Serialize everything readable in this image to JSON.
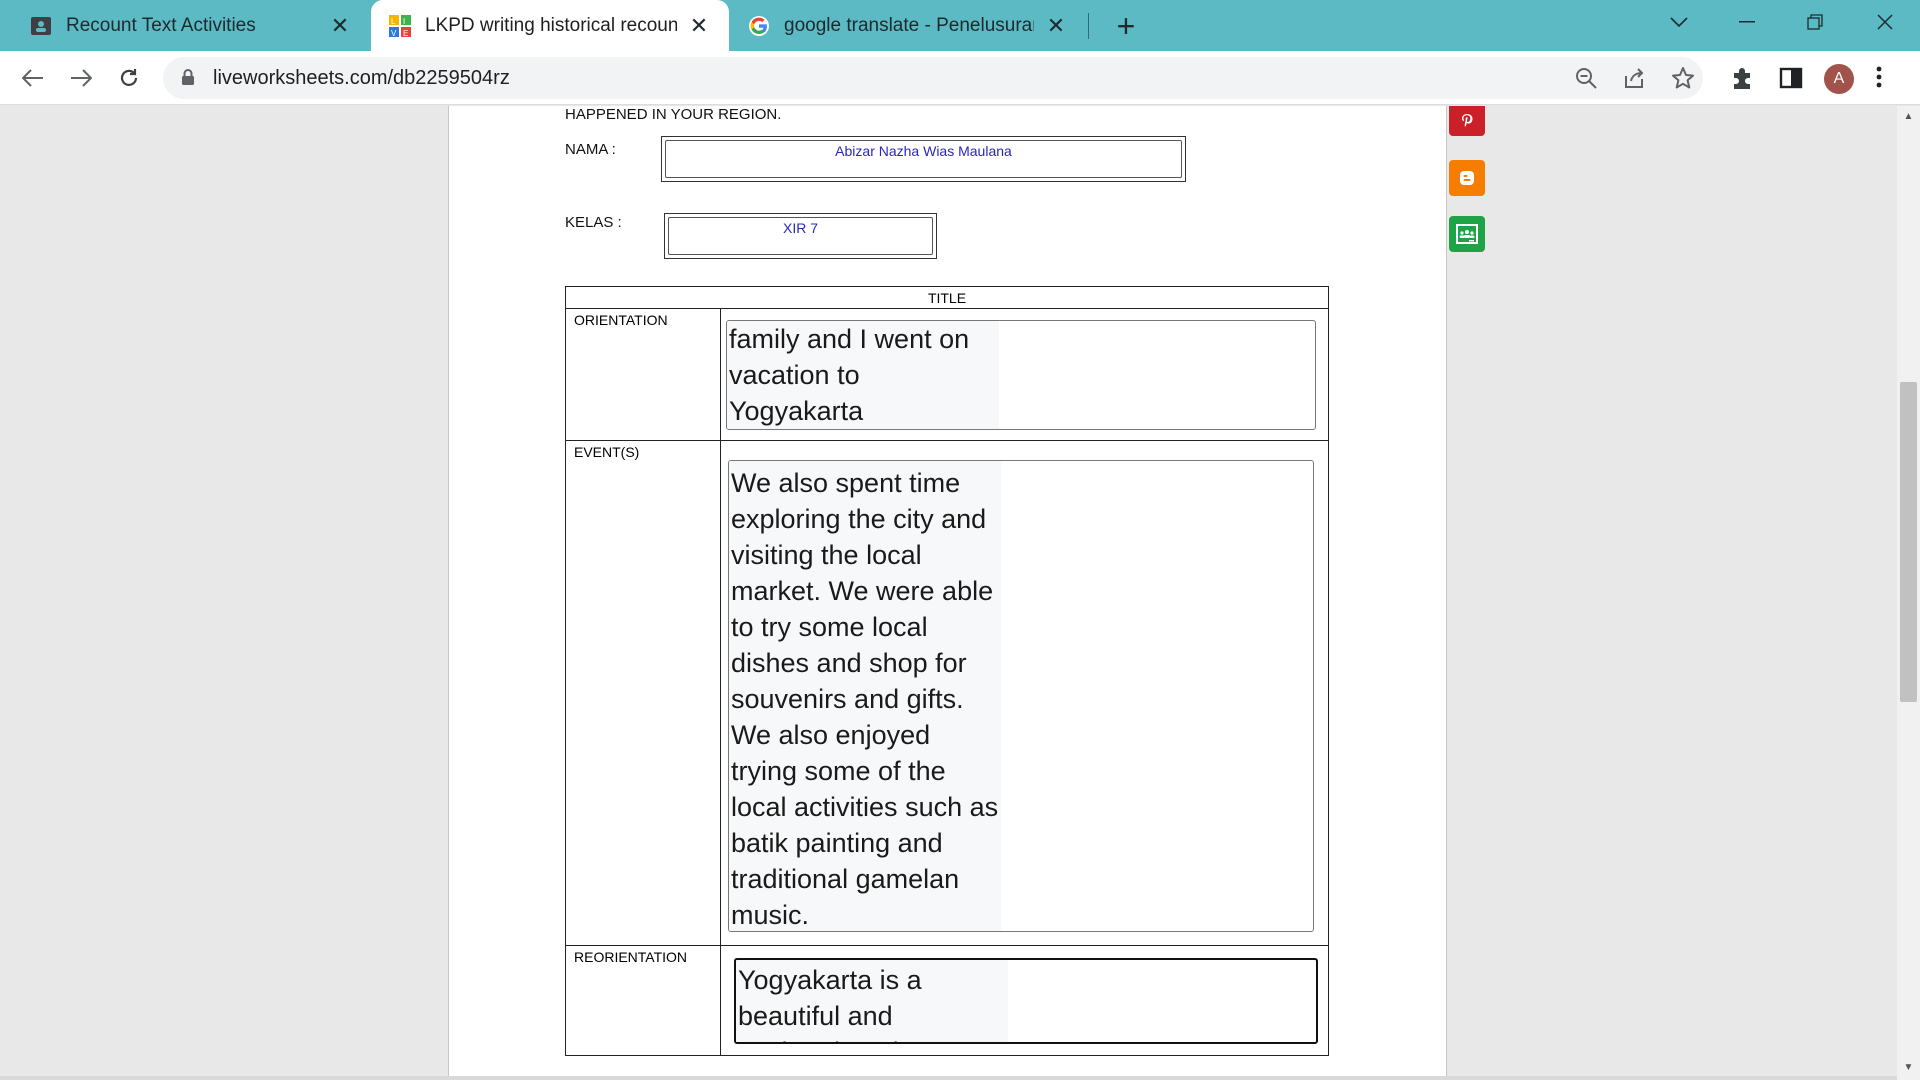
{
  "browser": {
    "tabs": [
      {
        "title": "Recount Text Activities",
        "favicon": "classroom-icon",
        "active": false
      },
      {
        "title": "LKPD writing historical recount w",
        "favicon": "liveworksheets-icon",
        "active": true
      },
      {
        "title": "google translate - Penelusuran G",
        "favicon": "google-icon",
        "active": false
      }
    ],
    "new_tab_label": "+",
    "url": "liveworksheets.com/db2259504rz",
    "profile_initial": "A",
    "colors": {
      "tabstrip": "#5bbac4",
      "avatar": "#a0524b"
    }
  },
  "worksheet": {
    "heading_fragment": "HAPPENED IN YOUR REGION.",
    "nama_label": "NAMA   :",
    "nama_value": "Abizar Nazha Wias Maulana",
    "kelas_label": "KELAS   :",
    "kelas_value": "XIR 7",
    "table": {
      "title_header": "TITLE",
      "rows": [
        {
          "label": "ORIENTATION",
          "answer": "family and I went on vacation to Yogyakarta"
        },
        {
          "label": "EVENT(S)",
          "answer": "We also spent time exploring the city and visiting the local market. We were able to try some local dishes and shop for souvenirs and gifts. We also enjoyed trying some of the local activities such as batik painting and traditional gamelan music."
        },
        {
          "label": "REORIENTATION",
          "answer": "Yogyakarta is a beautiful and enchanting place"
        }
      ]
    }
  },
  "share_buttons": [
    {
      "name": "pinterest-icon",
      "color": "#cb2027"
    },
    {
      "name": "blogger-icon",
      "color": "#f57d00"
    },
    {
      "name": "google-classroom-icon",
      "color": "#1ea446"
    }
  ]
}
